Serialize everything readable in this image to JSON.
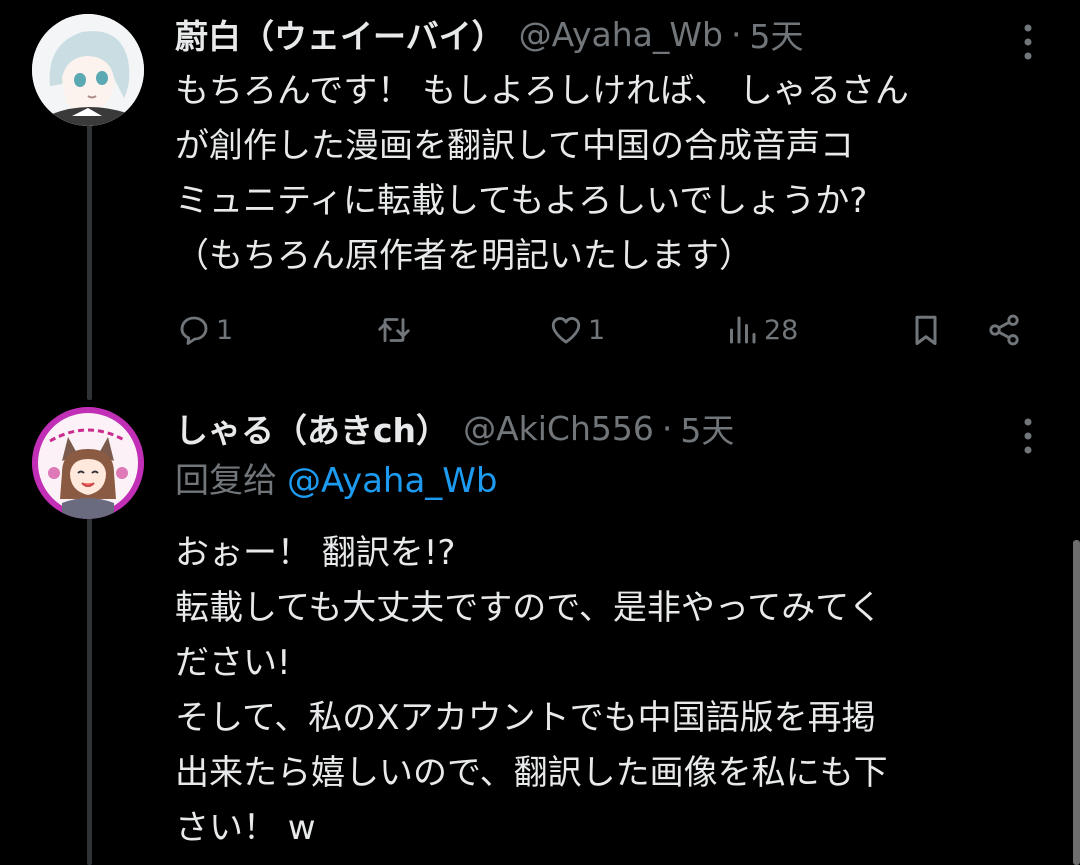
{
  "tweets": [
    {
      "display_name": "蔚白（ウェイーバイ）",
      "handle": "@Ayaha_Wb",
      "dot": "·",
      "time": "5天",
      "text": "もちろんです！ もしよろしければ、 しゃるさん\nが創作した漫画を翻訳して中国の合成音声コ\nミュニティに転載してもよろしいでしょうか?\n（もちろん原作者を明記いたします）",
      "avatar_icon": "anime-avatar-silver-hair",
      "actions": {
        "reply": {
          "icon": "reply-icon",
          "count": "1"
        },
        "retweet": {
          "icon": "retweet-icon",
          "count": ""
        },
        "like": {
          "icon": "heart-icon",
          "count": "1"
        },
        "views": {
          "icon": "analytics-icon",
          "count": "28"
        },
        "bookmark": {
          "icon": "bookmark-icon"
        },
        "share": {
          "icon": "share-icon"
        }
      }
    },
    {
      "display_name": "しゃる（あきch）",
      "handle": "@AkiCh556",
      "dot": "·",
      "time": "5天",
      "reply_prefix": "回复给",
      "reply_to": "@Ayaha_Wb",
      "text": "おぉー！ 翻訳を!?\n転載しても大丈夫ですので、是非やってみてく\nださい!\nそして、私のXアカウントでも中国語版を再掲\n出来たら嬉しいので、翻訳した画像を私にも下\nさい！ w",
      "avatar_icon": "anime-avatar-cat-ears"
    }
  ],
  "colors": {
    "background": "#000000",
    "text_primary": "#e7e9ea",
    "text_secondary": "#71767b",
    "link": "#1d9bf0",
    "thread_line": "#2f3336",
    "avatar_ring": "#c02fb6"
  }
}
